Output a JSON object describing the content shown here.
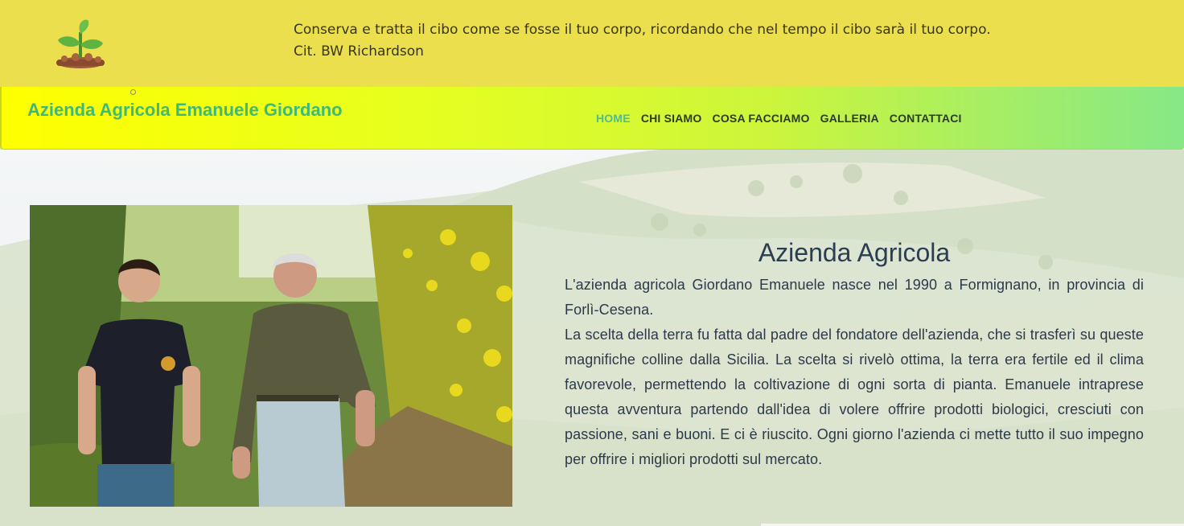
{
  "header": {
    "quote_line1": "Conserva e tratta il cibo come se fosse il tuo corpo, ricordando che nel tempo il cibo sarà il tuo corpo.",
    "quote_line2": "Cit. BW Richardson",
    "logo_icon": "sprout-icon"
  },
  "nav": {
    "brand": "Azienda Agricola Emanuele Giordano",
    "items": [
      {
        "label": "HOME",
        "active": true
      },
      {
        "label": "CHI SIAMO"
      },
      {
        "label": "COSA FACCIAMO"
      },
      {
        "label": "GALLERIA"
      },
      {
        "label": "CONTATTACI"
      }
    ]
  },
  "main": {
    "title": "Azienda Agricola",
    "paragraph1": "L'azienda agricola Giordano Emanuele nasce nel 1990 a Formignano, in provincia di Forlì-Cesena.",
    "paragraph2": "La scelta della terra fu fatta dal padre del fondatore dell'azienda, che si trasferì su queste magnifiche colline dalla Sicilia. La scelta si rivelò ottima, la terra era fertile ed il clima favorevole, permettendo la coltivazione di ogni sorta di pianta. Emanuele intraprese questa avventura partendo dall'idea di volere offrire prodotti biologici, cresciuti con passione, sani e buoni. E ci è riuscito. Ogni giorno l'azienda ci mette tutto il suo impegno per offrire i migliori prodotti sul mercato.",
    "photo": "two-farmers-photo"
  },
  "colors": {
    "topbar": "#ebdf4e",
    "brand": "#3fb97a",
    "active_nav": "#4fbc95",
    "text": "#2a3a4a"
  }
}
